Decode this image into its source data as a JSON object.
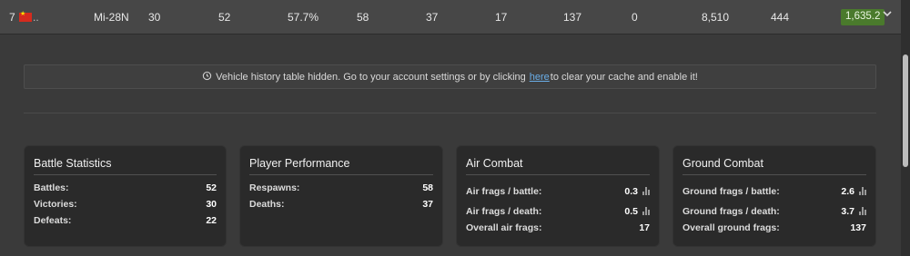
{
  "vehicle_row": {
    "rank": "7",
    "flag_overflow": "..",
    "name": "Mi-28N",
    "cells": [
      "30",
      "52",
      "57.7%",
      "58",
      "37",
      "17",
      "137",
      "0",
      "8,510",
      "444"
    ],
    "rating": "1,635.2",
    "rating_color": "#4a7a2c",
    "flag_color": "#d52b1e",
    "expand_icon": "chevron-down-icon"
  },
  "notice": {
    "icon": "history-icon",
    "text_before": "Vehicle history table hidden. Go to your account settings or by clicking",
    "link_text": "here",
    "text_after": "to clear your cache and enable it!",
    "link_color": "#6aaee8"
  },
  "cards": {
    "battle": {
      "title": "Battle Statistics",
      "rows": [
        {
          "label": "Battles:",
          "value": "52"
        },
        {
          "label": "Victories:",
          "value": "30"
        },
        {
          "label": "Defeats:",
          "value": "22"
        }
      ]
    },
    "performance": {
      "title": "Player Performance",
      "rows": [
        {
          "label": "Respawns:",
          "value": "58"
        },
        {
          "label": "Deaths:",
          "value": "37"
        }
      ]
    },
    "air": {
      "title": "Air Combat",
      "rows": [
        {
          "label": "Air frags / battle:",
          "value": "0.3"
        },
        {
          "label": "Air frags / death:",
          "value": "0.5"
        },
        {
          "label": "Overall air frags:",
          "value": "17"
        }
      ]
    },
    "ground": {
      "title": "Ground Combat",
      "rows": [
        {
          "label": "Ground frags / battle:",
          "value": "2.6"
        },
        {
          "label": "Ground frags / death:",
          "value": "3.7"
        },
        {
          "label": "Overall ground frags:",
          "value": "137"
        }
      ]
    }
  }
}
